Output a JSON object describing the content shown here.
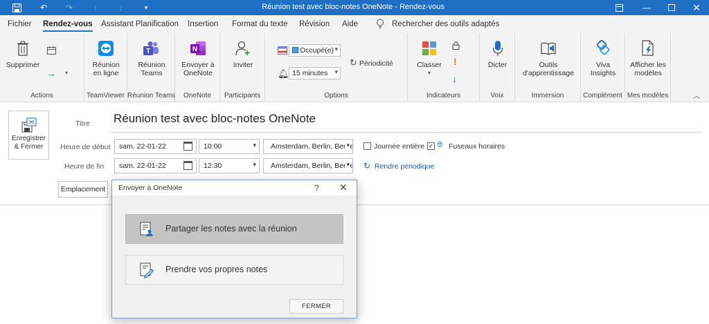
{
  "window": {
    "title": "Réunion test avec bloc-notes OneNote  -  Rendez-vous"
  },
  "menu": {
    "tabs": [
      "Fichier",
      "Rendez-vous",
      "Assistant Planification",
      "Insertion",
      "Format du texte",
      "Révision",
      "Aide"
    ],
    "active_tab": "Rendez-vous",
    "search": "Rechercher des outils adaptés"
  },
  "ribbon": {
    "groups": {
      "actions": "Actions",
      "teamviewer": "TeamViewer",
      "teams": "Réunion Teams",
      "onenote": "OneNote",
      "participants": "Participants",
      "options": "Options",
      "indicateurs": "Indicateurs",
      "voix": "Voix",
      "immersion": "Immersion",
      "complement": "Complément",
      "modeles": "Mes modèles"
    },
    "buttons": {
      "supprimer": "Supprimer",
      "reunion_en_ligne": [
        "Réunion",
        "en ligne"
      ],
      "reunion_teams": [
        "Réunion",
        "Teams"
      ],
      "envoyer_onenote": [
        "Envoyer à",
        "OneNote"
      ],
      "inviter": "Inviter",
      "occupe": "Occupé(e)",
      "rappel": "15 minutes",
      "periodicite": "Périodicité",
      "classer": "Classer",
      "dicter": "Dicter",
      "outils": [
        "Outils",
        "d'apprentissage"
      ],
      "viva": [
        "Viva",
        "Insights"
      ],
      "afficher_modeles": [
        "Afficher les",
        "modèles"
      ]
    },
    "colors": {
      "onenote": "#7719aa",
      "teams": "#5b5fc7",
      "teamviewer": "#0e8ee9"
    }
  },
  "form": {
    "save_close": [
      "Enregistrer",
      "& Fermer"
    ],
    "labels": {
      "title": "Titre",
      "start": "Heure de début",
      "end": "Heure de fin"
    },
    "subject": "Réunion test avec bloc-notes OneNote",
    "start_date": "sam. 22-01-22",
    "start_time": "10:00",
    "start_tz": "Amsterdam, Berlin, Berne",
    "end_date": "sam. 22-01-22",
    "end_time": "12:30",
    "end_tz": "Amsterdam, Berlin, Berne",
    "all_day": "Journée entière",
    "all_day_checked": false,
    "time_zones": "Fuseaux horaires",
    "time_zones_checked": true,
    "make_recurring": "Rendre périodique",
    "location_button": "Emplacement"
  },
  "dialog": {
    "title": "Envoyer à OneNote",
    "help": "?",
    "close": "✕",
    "options": [
      {
        "label": "Partager les notes avec la réunion",
        "selected": true
      },
      {
        "label": "Prendre vos propres notes",
        "selected": false
      }
    ],
    "close_button": "FERMER"
  }
}
